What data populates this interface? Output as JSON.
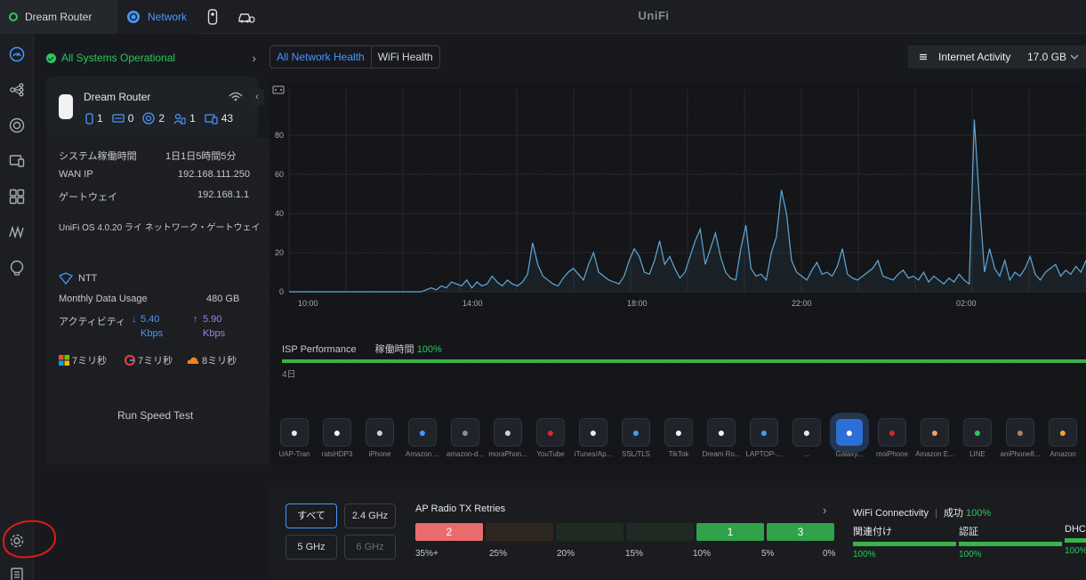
{
  "top": {
    "tabs": [
      {
        "label": "Dream Router"
      },
      {
        "label": "Network"
      }
    ],
    "brand": "UniFi"
  },
  "status": {
    "text": "All Systems Operational"
  },
  "router": {
    "name": "Dream Router",
    "stats": [
      "1",
      "0",
      "2",
      "1",
      "43"
    ]
  },
  "info": {
    "rows": [
      {
        "key": "システム稼働時間",
        "value": "1日1日5時間5分"
      },
      {
        "key": "WAN IP",
        "value": "192.168.111.250"
      },
      {
        "key": "ゲートウェイ",
        "value": "192.168.1.1"
      }
    ],
    "version": "UniFi OS 4.0.20 ライ ネットワーク・ゲートウェイ",
    "isp": "NTT",
    "usage_label": "Monthly Data Usage",
    "usage_value": "480 GB",
    "speed_label": "アクティビティ",
    "down": "5.40",
    "down_unit": "Kbps",
    "up": "5.90",
    "up_unit": "Kbps",
    "latency": [
      "7ミリ秒",
      "7ミリ秒",
      "8ミリ秒"
    ],
    "speed_test": "Run Speed Test"
  },
  "health_tabs": {
    "active": "All Network Health",
    "other": "WiFi Health"
  },
  "activity": {
    "label": "Internet Activity",
    "value": "17.0 GB"
  },
  "chart_data": {
    "type": "line",
    "y_ticks": [
      "80",
      "60",
      "40",
      "20",
      "0"
    ],
    "x_ticks": [
      "10:00",
      "14:00",
      "18:00",
      "22:00",
      "02:00"
    ],
    "ylim": [
      0,
      100
    ],
    "series": [
      {
        "values": [
          0,
          0,
          0,
          0,
          0,
          0,
          0,
          0,
          0,
          0,
          0,
          0,
          0,
          0,
          0,
          0,
          0,
          0,
          0,
          0,
          0,
          0,
          0,
          0,
          0,
          0,
          0,
          1,
          2,
          1,
          3,
          2,
          5,
          4,
          3,
          6,
          2,
          5,
          3,
          4,
          8,
          5,
          3,
          6,
          4,
          3,
          5,
          9,
          25,
          14,
          8,
          6,
          4,
          3,
          7,
          10,
          12,
          9,
          6,
          14,
          20,
          10,
          8,
          6,
          5,
          4,
          8,
          16,
          22,
          18,
          10,
          9,
          16,
          26,
          14,
          18,
          12,
          7,
          10,
          18,
          26,
          32,
          14,
          22,
          30,
          18,
          10,
          7,
          6,
          22,
          34,
          12,
          8,
          9,
          6,
          20,
          28,
          52,
          40,
          16,
          10,
          8,
          6,
          11,
          15,
          9,
          10,
          8,
          13,
          22,
          9,
          7,
          6,
          8,
          10,
          12,
          16,
          8,
          7,
          6,
          9,
          11,
          7,
          8,
          6,
          10,
          5,
          8,
          6,
          4,
          7,
          5,
          9,
          6,
          4,
          88,
          46,
          10,
          22,
          12,
          8,
          16,
          6,
          10,
          8,
          12,
          18,
          9,
          6,
          10,
          12,
          14,
          8,
          11,
          9,
          13,
          10,
          16
        ]
      }
    ]
  },
  "isp_perf": {
    "label": "ISP Performance",
    "uptime_label": "稼働時間",
    "uptime_value": "100%",
    "tick": "4日"
  },
  "apps": [
    {
      "label": "UAP-Tran",
      "color": "#e8e8e8"
    },
    {
      "label": "ratsHDP3",
      "color": "#f2f2f2"
    },
    {
      "label": "iPhone",
      "color": "#d0d0d0"
    },
    {
      "label": "Amazon ...",
      "color": "#4797ff"
    },
    {
      "label": "amazon-d...",
      "color": "#8a8d93"
    },
    {
      "label": "moraPhon...",
      "color": "#d0d0d0"
    },
    {
      "label": "YouTube",
      "color": "#e02424"
    },
    {
      "label": "iTunes/Ap...",
      "color": "#e8e8e8"
    },
    {
      "label": "SSL/TLS",
      "color": "#4797ff"
    },
    {
      "label": "TikTok",
      "color": "#f2f2f2"
    },
    {
      "label": "Dream Ro...",
      "color": "#f2f2f2"
    },
    {
      "label": "LAPTOP-...",
      "color": "#4797ff"
    },
    {
      "label": "...",
      "color": "#e8e8e8"
    },
    {
      "label": "Galaxy...",
      "color": "#ffffff"
    },
    {
      "label": "moiPhone",
      "color": "#e02424"
    },
    {
      "label": "Amazon E...",
      "color": "#e8a060"
    },
    {
      "label": "LINE",
      "color": "#2ec75d"
    },
    {
      "label": "aniPhone8...",
      "color": "#b08060"
    },
    {
      "label": "Amazon",
      "color": "#f0a030"
    }
  ],
  "bands": {
    "all": "すべて",
    "b24": "2.4 GHz",
    "b5": "5 GHz",
    "b6": "6 GHz"
  },
  "retries": {
    "title": "AP Radio TX Retries",
    "segments": [
      {
        "value": "2",
        "color": "#e86c6c"
      },
      {
        "value": "",
        "color": "#2e2620"
      },
      {
        "value": "",
        "color": "#1e2a22"
      },
      {
        "value": "",
        "color": "#1f2a23"
      },
      {
        "value": "1",
        "color": "#2fa24a"
      },
      {
        "value": "3",
        "color": "#2fa24a"
      }
    ],
    "ticks": [
      "35%+",
      "25%",
      "20%",
      "15%",
      "10%",
      "5%",
      "0%"
    ]
  },
  "wifi": {
    "title": "WiFi Connectivity",
    "success_label": "成功",
    "success_pct": "100%",
    "cols": [
      {
        "label": "関連付け",
        "pct": "100%"
      },
      {
        "label": "認証",
        "pct": "100%"
      },
      {
        "label": "DHCP",
        "pct": "100%"
      }
    ]
  }
}
